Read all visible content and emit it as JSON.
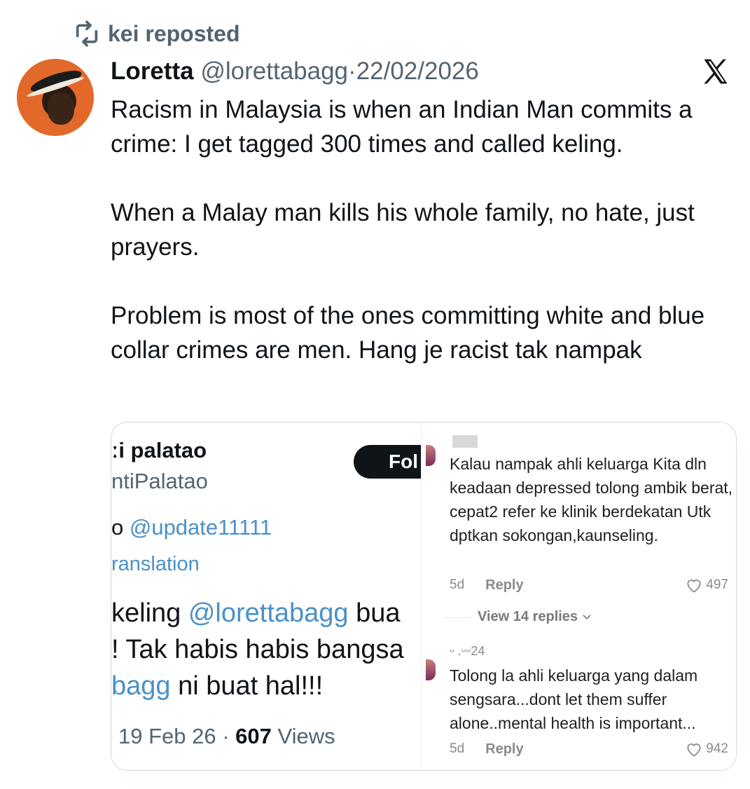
{
  "repost": {
    "text": "kei reposted",
    "icon": "repost-icon"
  },
  "tweet": {
    "author_name": "Loretta",
    "handle": "@lorettabagg",
    "separator": "·",
    "date": "22/02/2026",
    "paragraphs": [
      "Racism in Malaysia is when an Indian Man commits a crime: I get tagged 300 times and called keling.",
      "When a Malay man kills his whole family, no hate, just prayers.",
      "Problem is most of the ones committing white and blue collar crimes are men. Hang je racist tak nampak"
    ],
    "platform_icon": "x-logo-icon"
  },
  "quoted_screenshot": {
    "name": "ːi palatao",
    "handle": "ntiPalatao",
    "follow_label": "Fol",
    "replying_prefix": "o ",
    "replying_mention": "@update11111",
    "translation_label": "ranslation",
    "text_line1_prefix": "keling ",
    "text_line1_mention": "@lorettabagg",
    "text_line1_suffix": " bua",
    "text_line2": "! Tak habis habis bangsa",
    "text_line3_mention": "bagg",
    "text_line3_suffix": " ni buat hal!!!",
    "date": "19 Feb 26",
    "separator": " · ",
    "views_count": "607",
    "views_label": " Views"
  },
  "comments": [
    {
      "text": "Kalau nampak ahli keluarga Kita dln keadaan depressed tolong ambik berat, cepat2 refer ke klinik berdekatan Utk dptkan sokongan,kaunseling.",
      "age": "5d",
      "reply_label": "Reply",
      "likes": "497"
    },
    {
      "partial_name": "ᵕ .ᵕᵕ24",
      "text": "Tolong la ahli keluarga yang dalam sengsara...dont let them suffer alone..mental health is important...",
      "age": "5d",
      "reply_label": "Reply",
      "likes": "942"
    }
  ],
  "view_replies_label": "View 14 replies",
  "colors": {
    "link": "#4a90c8",
    "secondary": "#536471",
    "avatar_orange": "#e2692a"
  }
}
